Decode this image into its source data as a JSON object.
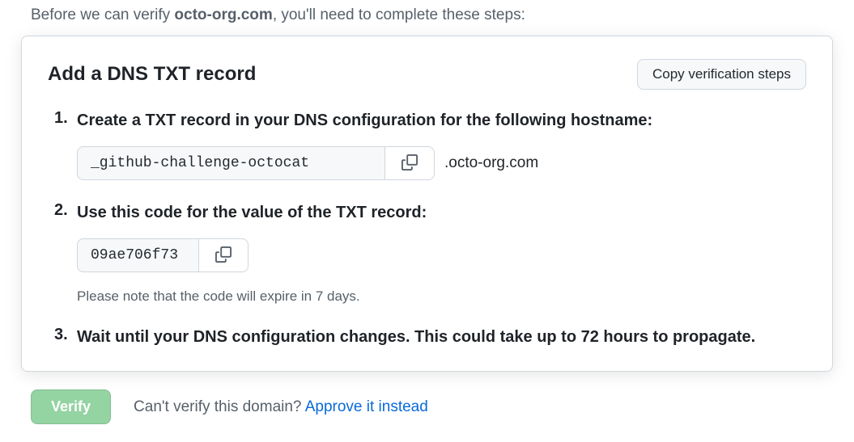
{
  "intro": {
    "prefix": "Before we can verify ",
    "domain": "octo-org.com",
    "suffix": ", you'll need to complete these steps:"
  },
  "card": {
    "title": "Add a DNS TXT record",
    "copy_steps_label": "Copy verification steps"
  },
  "steps": {
    "s1": {
      "title": "Create a TXT record in your DNS configuration for the following hostname:",
      "hostname": "_github-challenge-octocat",
      "suffix": ".octo-org.com"
    },
    "s2": {
      "title": "Use this code for the value of the TXT record:",
      "code": "09ae706f73",
      "note": "Please note that the code will expire in 7 days."
    },
    "s3": {
      "title": "Wait until your DNS configuration changes. This could take up to 72 hours to propagate."
    }
  },
  "footer": {
    "verify_label": "Verify",
    "question": "Can't verify this domain? ",
    "link": "Approve it instead"
  }
}
